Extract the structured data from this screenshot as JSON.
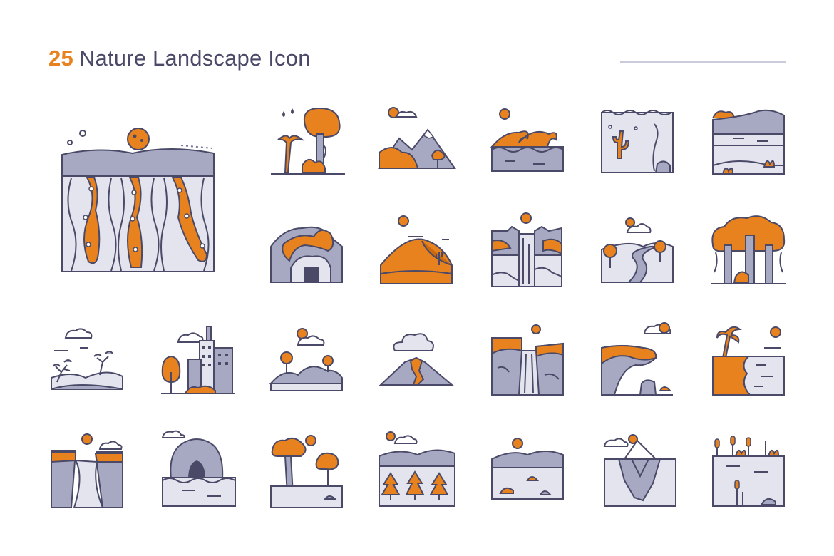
{
  "header": {
    "count": "25",
    "title": "Nature Landscape Icon"
  },
  "palette": {
    "orange": "#e8821e",
    "gray": "#a7a9c3",
    "light": "#e3e4ee",
    "outline": "#4a4a68"
  },
  "icons": [
    "lava-field-icon",
    "jungle-icon",
    "mountains-icon",
    "ocean-waves-icon",
    "underwater-icon",
    "lake-icon",
    "cave-icon",
    "desert-dunes-icon",
    "waterfall-icon",
    "river-icon",
    "rainforest-icon",
    "savanna-icon",
    "city-icon",
    "hills-icon",
    "volcano-icon",
    "canyon-waterfall-icon",
    "cliff-icon",
    "beach-icon",
    "ravine-icon",
    "sea-cave-icon",
    "trees-icon",
    "pine-forest-icon",
    "valley-icon",
    "iceberg-icon",
    "swamp-icon"
  ]
}
